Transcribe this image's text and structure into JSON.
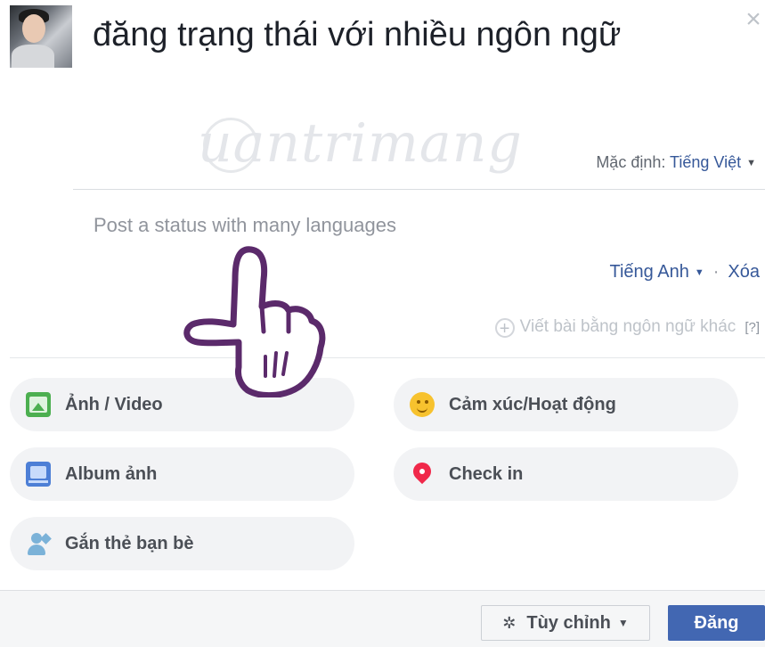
{
  "header": {
    "title": "đăng trạng thái với nhiều ngôn ngữ",
    "close_icon": "close-icon"
  },
  "watermark": {
    "text": "uantrimang"
  },
  "composer": {
    "default_label": "Mặc định:",
    "default_language": "Tiếng Việt",
    "placeholder": "Post a status with many languages",
    "current_language": "Tiếng Anh",
    "remove_label": "Xóa",
    "other_language_label": "Viết bài bằng ngôn ngữ khác",
    "help_label": "[?]"
  },
  "options": [
    {
      "label": "Ảnh / Video",
      "icon": "photo-video-icon"
    },
    {
      "label": "Cảm xúc/Hoạt động",
      "icon": "smile-icon"
    },
    {
      "label": "Album ảnh",
      "icon": "album-icon"
    },
    {
      "label": "Check in",
      "icon": "location-pin-icon"
    },
    {
      "label": "Gắn thẻ bạn bè",
      "icon": "tag-friends-icon"
    }
  ],
  "footer": {
    "customize_label": "Tùy chỉnh",
    "post_label": "Đăng"
  },
  "colors": {
    "link": "#365899",
    "primary_button": "#4267b2",
    "chip_background": "#f2f3f5",
    "annotation_hand": "#5b2a6b"
  }
}
